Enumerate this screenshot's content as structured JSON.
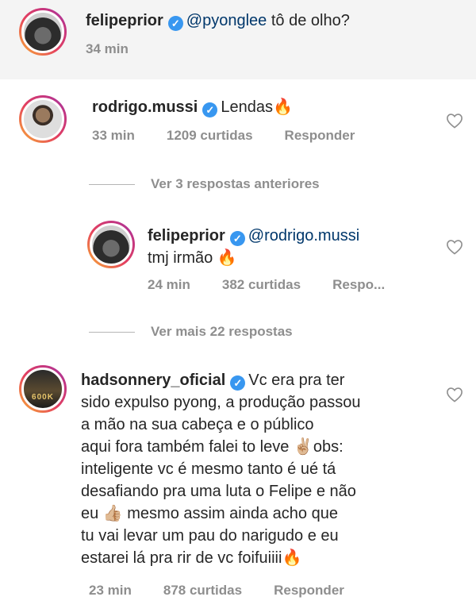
{
  "comments": [
    {
      "username": "felipeprior",
      "mention": "@pyonglee",
      "text_after": " tô de olho?",
      "time": "34 min"
    },
    {
      "username": "rodrigo.mussi",
      "text": "Lendas",
      "emoji": "🔥",
      "time": "33 min",
      "likes": "1209 curtidas",
      "reply": "Responder"
    }
  ],
  "view_previous": "Ver 3 respostas anteriores",
  "reply_comment": {
    "username": "felipeprior",
    "mention": "@rodrigo.mussi",
    "text": "tmj irmão",
    "emoji": "🔥",
    "time": "24 min",
    "likes": "382 curtidas",
    "reply": "Respo..."
  },
  "view_more": "Ver mais 22 respostas",
  "long_comment": {
    "username": "hadsonnery_oficial",
    "avatar_text": "600K",
    "line1": "Vc era pra ter",
    "line2": "sido expulso pyong, a produção passou",
    "line3": "a mão na sua cabeça e o público",
    "line4a": "aqui fora também falei to leve ",
    "emoji_victory": "✌🏼",
    "line4b": "obs:",
    "line5": "inteligente vc é mesmo tanto é ué tá",
    "line6": "desafiando pra uma luta o Felipe e não",
    "line7a": "eu ",
    "emoji_thumb": "👍🏼",
    "line7b": " mesmo assim ainda acho que",
    "line8": "tu vai levar um pau do narigudo e eu",
    "line9": "estarei lá pra rir de vc foifuiiii",
    "emoji_fire": "🔥",
    "time": "23 min",
    "likes": "878 curtidas",
    "reply": "Responder"
  },
  "icons": {
    "verified": "verified-badge-icon",
    "heart": "heart-outline-icon"
  },
  "colors": {
    "verified": "#3897f0",
    "mention": "#00376b",
    "meta": "#8e8e8e"
  }
}
